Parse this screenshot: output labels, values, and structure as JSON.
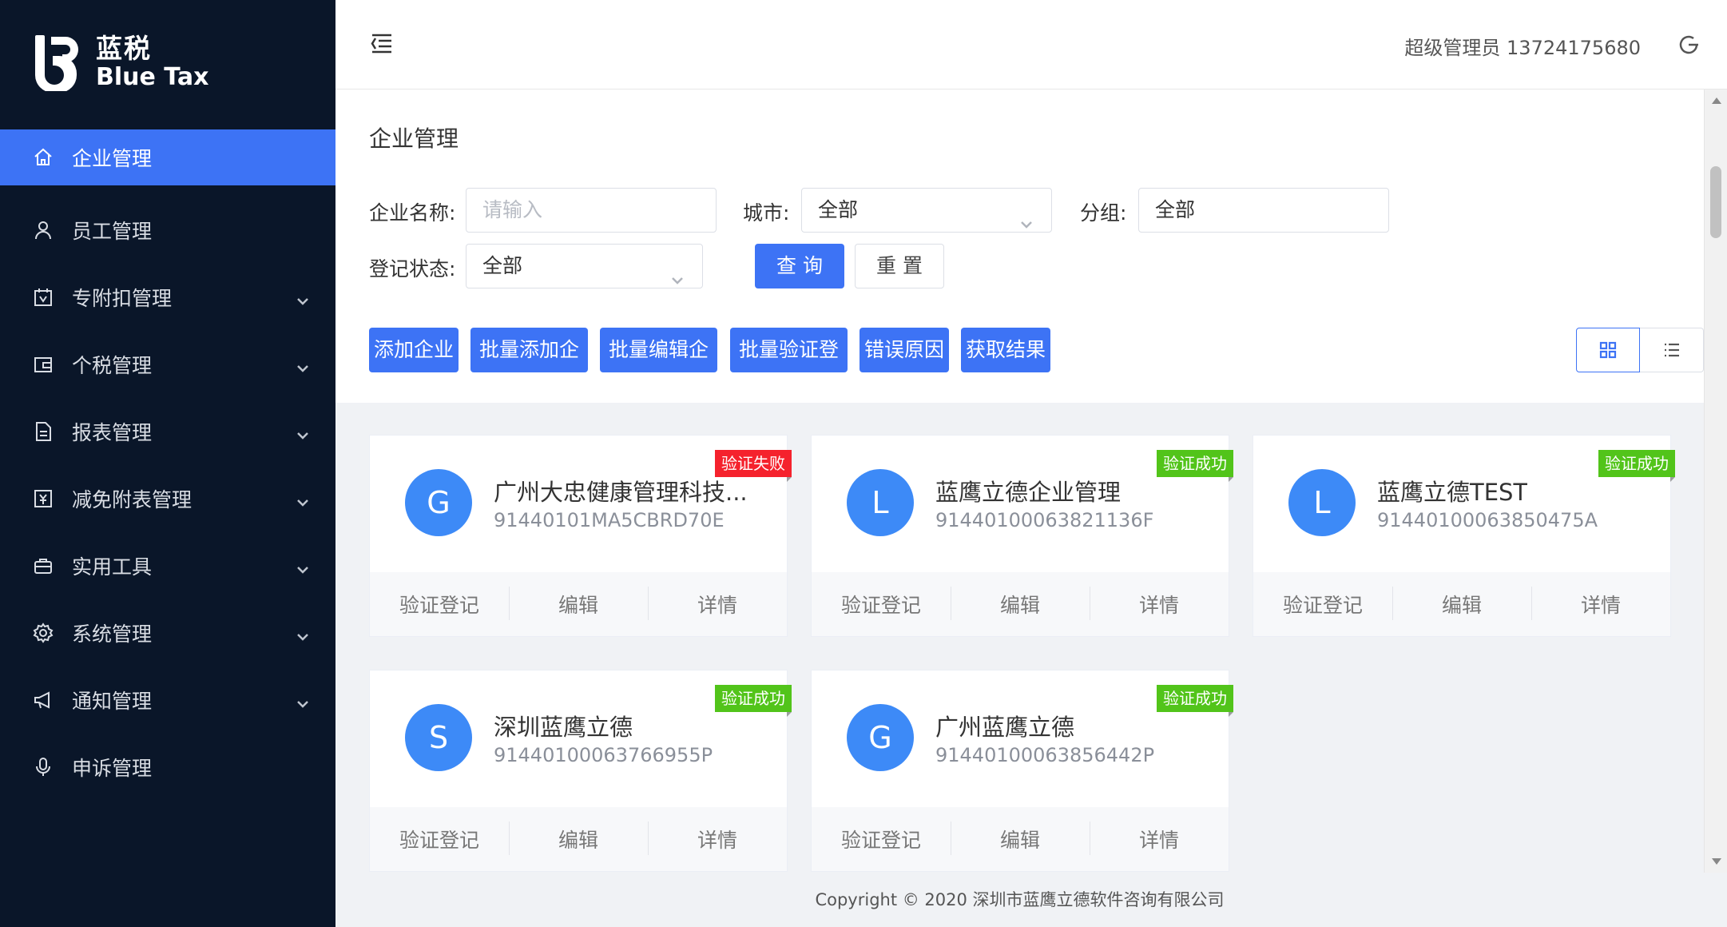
{
  "brand": {
    "cn": "蓝税",
    "en": "Blue Tax"
  },
  "colors": {
    "sidebar_bg": "#0a1629",
    "accent": "#3d73f5",
    "success": "#52c41a",
    "danger": "#f5222d",
    "avatar": "#3d8af7"
  },
  "menu": [
    {
      "label": "企业管理",
      "icon": "home-icon",
      "active": true,
      "expandable": false
    },
    {
      "label": "员工管理",
      "icon": "user-icon",
      "active": false,
      "expandable": false
    },
    {
      "label": "专附扣管理",
      "icon": "calendar-icon",
      "active": false,
      "expandable": true
    },
    {
      "label": "个税管理",
      "icon": "wallet-icon",
      "active": false,
      "expandable": true
    },
    {
      "label": "报表管理",
      "icon": "document-icon",
      "active": false,
      "expandable": true
    },
    {
      "label": "减免附表管理",
      "icon": "yen-icon",
      "active": false,
      "expandable": true
    },
    {
      "label": "实用工具",
      "icon": "toolbox-icon",
      "active": false,
      "expandable": true
    },
    {
      "label": "系统管理",
      "icon": "gear-icon",
      "active": false,
      "expandable": true
    },
    {
      "label": "通知管理",
      "icon": "megaphone-icon",
      "active": false,
      "expandable": true
    },
    {
      "label": "申诉管理",
      "icon": "microphone-icon",
      "active": false,
      "expandable": false
    }
  ],
  "header": {
    "user": "超级管理员 13724175680"
  },
  "page": {
    "title": "企业管理"
  },
  "filters": {
    "company_name_label": "企业名称:",
    "company_name_placeholder": "请输入",
    "city_label": "城市:",
    "city_value": "全部",
    "group_label": "分组:",
    "group_value": "全部",
    "status_label": "登记状态:",
    "status_value": "全部",
    "query": "查 询",
    "reset": "重 置"
  },
  "toolbar": [
    "添加企业",
    "批量添加企业",
    "批量编辑企业",
    "批量验证登记",
    "错误原因",
    "获取结果"
  ],
  "view_toggle": {
    "active": "grid"
  },
  "companies": [
    {
      "initial": "G",
      "name": "广州大忠健康管理科技...",
      "code": "91440101MA5CBRD70E",
      "status": "验证失败",
      "status_type": "fail"
    },
    {
      "initial": "L",
      "name": "蓝鹰立德企业管理",
      "code": "91440100063821136F",
      "status": "验证成功",
      "status_type": "ok"
    },
    {
      "initial": "L",
      "name": "蓝鹰立德TEST",
      "code": "91440100063850475A",
      "status": "验证成功",
      "status_type": "ok"
    },
    {
      "initial": "S",
      "name": "深圳蓝鹰立德",
      "code": "91440100063766955P",
      "status": "验证成功",
      "status_type": "ok"
    },
    {
      "initial": "G",
      "name": "广州蓝鹰立德",
      "code": "91440100063856442P",
      "status": "验证成功",
      "status_type": "ok"
    }
  ],
  "card_actions": [
    "验证登记",
    "编辑",
    "详情"
  ],
  "footer": "Copyright © 2020 深圳市蓝鹰立德软件咨询有限公司"
}
